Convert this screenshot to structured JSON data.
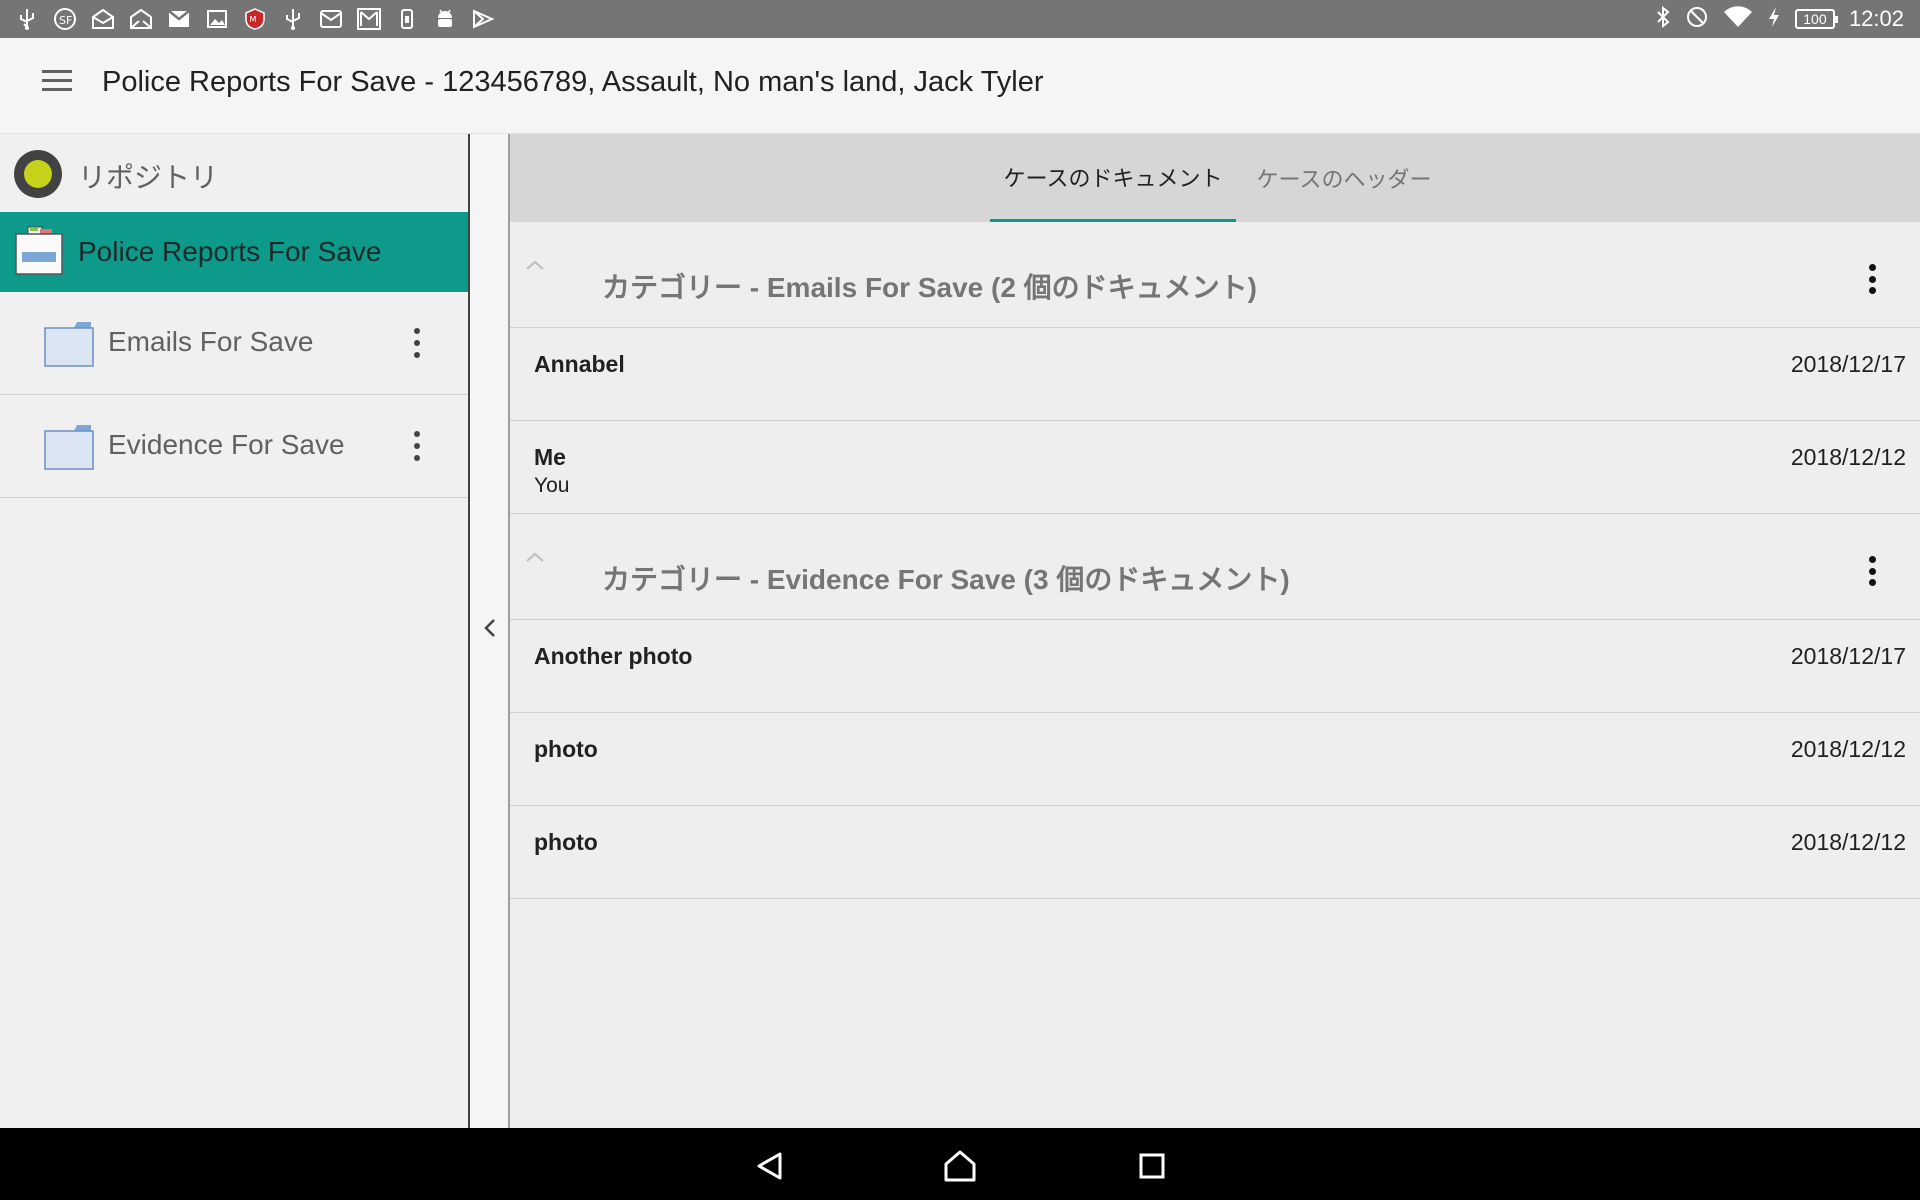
{
  "status_bar": {
    "time": "12:02",
    "battery": "100",
    "left_icons": [
      "usb-icon",
      "sf-icon",
      "mail-open-icon",
      "mail-open-icon",
      "gmail-icon",
      "image-icon",
      "mcafee-icon",
      "usb-icon",
      "mail-icon",
      "gmail-icon",
      "phone-icon",
      "android-icon",
      "play-icon"
    ],
    "right_icons": [
      "bluetooth-icon",
      "do-not-disturb-icon",
      "wifi-icon",
      "charging-icon"
    ]
  },
  "app_bar": {
    "title": "Police Reports For Save - 123456789, Assault, No man's land, Jack Tyler"
  },
  "sidebar": {
    "repository_label": "リポジトリ",
    "case_label": "Police Reports For Save",
    "categories": [
      {
        "label": "Emails For Save"
      },
      {
        "label": "Evidence For Save"
      }
    ]
  },
  "tabs": [
    {
      "label": "ケースのドキュメント",
      "active": true
    },
    {
      "label": "ケースのヘッダー",
      "active": false
    }
  ],
  "groups": [
    {
      "title": "カテゴリー - Emails For Save (2 個のドキュメント)",
      "documents": [
        {
          "name": "Annabel",
          "subtitle": "",
          "date": "2018/12/17"
        },
        {
          "name": "Me",
          "subtitle": "You",
          "date": "2018/12/12"
        }
      ]
    },
    {
      "title": "カテゴリー - Evidence For Save (3 個のドキュメント)",
      "documents": [
        {
          "name": "Another photo",
          "subtitle": "",
          "date": "2018/12/17"
        },
        {
          "name": "photo",
          "subtitle": "",
          "date": "2018/12/12"
        },
        {
          "name": "photo",
          "subtitle": "",
          "date": "2018/12/12"
        }
      ]
    }
  ],
  "colors": {
    "accent": "#0e9a8a",
    "status_bar": "#757575",
    "repo_dot": "#c6d31b"
  }
}
